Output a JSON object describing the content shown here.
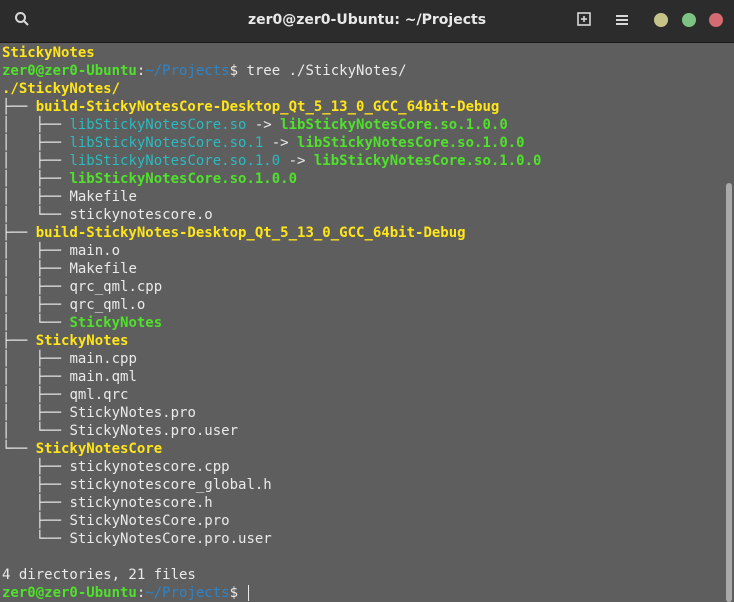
{
  "window": {
    "title": "zer0@zer0-Ubuntu: ~/Projects",
    "icons": {
      "search": "search-icon",
      "new_tab": "new-tab-icon",
      "menu": "hamburger-menu-icon",
      "minimize": "minimize-icon",
      "maximize": "maximize-icon",
      "close": "close-icon"
    },
    "colors": {
      "titlebar": "#2c2c2c",
      "terminal_bg": "#5e5e5e",
      "minimize": "#c6c38a",
      "maximize": "#7cc383",
      "close": "#d46a72",
      "prompt_user": "#4fe12b",
      "prompt_path": "#2f84c6",
      "directory": "#ffe51a",
      "executable": "#4fe12b",
      "symlink": "#2abbc0"
    }
  },
  "terminal": {
    "lines": [
      {
        "kind": "dir",
        "text": "StickyNotes"
      },
      {
        "kind": "prompt",
        "user": "zer0@zer0-Ubuntu",
        "sep": ":",
        "path": "~/Projects",
        "dollar": "$ ",
        "cmd": "tree ./StickyNotes/"
      },
      {
        "kind": "dir",
        "text": "./StickyNotes/"
      },
      {
        "kind": "tree",
        "prefix": "├── ",
        "name": "build-StickyNotesCore-Desktop_Qt_5_13_0_GCC_64bit-Debug",
        "type": "dir"
      },
      {
        "kind": "tree",
        "prefix": "│   ├── ",
        "name": "libStickyNotesCore.so",
        "type": "link",
        "target": "libStickyNotesCore.so.1.0.0"
      },
      {
        "kind": "tree",
        "prefix": "│   ├── ",
        "name": "libStickyNotesCore.so.1",
        "type": "link",
        "target": "libStickyNotesCore.so.1.0.0"
      },
      {
        "kind": "tree",
        "prefix": "│   ├── ",
        "name": "libStickyNotesCore.so.1.0",
        "type": "link",
        "target": "libStickyNotesCore.so.1.0.0"
      },
      {
        "kind": "tree",
        "prefix": "│   ├── ",
        "name": "libStickyNotesCore.so.1.0.0",
        "type": "exec"
      },
      {
        "kind": "tree",
        "prefix": "│   ├── ",
        "name": "Makefile",
        "type": "file"
      },
      {
        "kind": "tree",
        "prefix": "│   └── ",
        "name": "stickynotescore.o",
        "type": "file"
      },
      {
        "kind": "tree",
        "prefix": "├── ",
        "name": "build-StickyNotes-Desktop_Qt_5_13_0_GCC_64bit-Debug",
        "type": "dir"
      },
      {
        "kind": "tree",
        "prefix": "│   ├── ",
        "name": "main.o",
        "type": "file"
      },
      {
        "kind": "tree",
        "prefix": "│   ├── ",
        "name": "Makefile",
        "type": "file"
      },
      {
        "kind": "tree",
        "prefix": "│   ├── ",
        "name": "qrc_qml.cpp",
        "type": "file"
      },
      {
        "kind": "tree",
        "prefix": "│   ├── ",
        "name": "qrc_qml.o",
        "type": "file"
      },
      {
        "kind": "tree",
        "prefix": "│   └── ",
        "name": "StickyNotes",
        "type": "exec"
      },
      {
        "kind": "tree",
        "prefix": "├── ",
        "name": "StickyNotes",
        "type": "dir"
      },
      {
        "kind": "tree",
        "prefix": "│   ├── ",
        "name": "main.cpp",
        "type": "file"
      },
      {
        "kind": "tree",
        "prefix": "│   ├── ",
        "name": "main.qml",
        "type": "file"
      },
      {
        "kind": "tree",
        "prefix": "│   ├── ",
        "name": "qml.qrc",
        "type": "file"
      },
      {
        "kind": "tree",
        "prefix": "│   ├── ",
        "name": "StickyNotes.pro",
        "type": "file"
      },
      {
        "kind": "tree",
        "prefix": "│   └── ",
        "name": "StickyNotes.pro.user",
        "type": "file"
      },
      {
        "kind": "tree",
        "prefix": "└── ",
        "name": "StickyNotesCore",
        "type": "dir"
      },
      {
        "kind": "tree",
        "prefix": "    ├── ",
        "name": "stickynotescore.cpp",
        "type": "file"
      },
      {
        "kind": "tree",
        "prefix": "    ├── ",
        "name": "stickynotescore_global.h",
        "type": "file"
      },
      {
        "kind": "tree",
        "prefix": "    ├── ",
        "name": "stickynotescore.h",
        "type": "file"
      },
      {
        "kind": "tree",
        "prefix": "    ├── ",
        "name": "StickyNotesCore.pro",
        "type": "file"
      },
      {
        "kind": "tree",
        "prefix": "    └── ",
        "name": "StickyNotesCore.pro.user",
        "type": "file"
      },
      {
        "kind": "blank"
      },
      {
        "kind": "text",
        "text": "4 directories, 21 files"
      },
      {
        "kind": "prompt",
        "user": "zer0@zer0-Ubuntu",
        "sep": ":",
        "path": "~/Projects",
        "dollar": "$ ",
        "cmd": "",
        "cursor": true
      }
    ]
  }
}
